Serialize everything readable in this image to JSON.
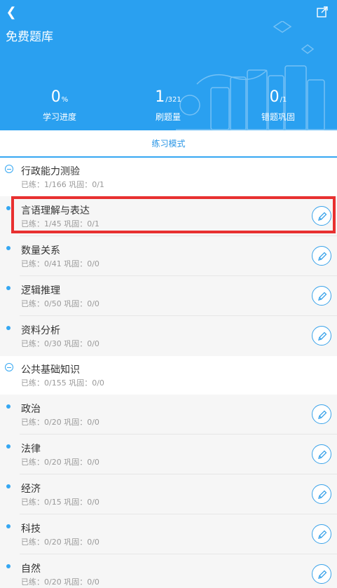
{
  "header": {
    "title": "免费题库",
    "bg_color": "#2aa0f0",
    "stats": [
      {
        "value": "0",
        "suffix": "%",
        "label": "学习进度"
      },
      {
        "value": "1",
        "suffix": "/321",
        "label": "刷题量"
      },
      {
        "value": "0",
        "suffix": "/1",
        "label": "错题巩固"
      }
    ]
  },
  "tab": {
    "label": "练习模式"
  },
  "groups": [
    {
      "title": "行政能力测验",
      "progress": "已练：1/166  巩固：0/1",
      "items": [
        {
          "name": "言语理解与表达",
          "progress": "已练：1/45  巩固：0/1"
        },
        {
          "name": "数量关系",
          "progress": "已练：0/41  巩固：0/0"
        },
        {
          "name": "逻辑推理",
          "progress": "已练：0/50  巩固：0/0"
        },
        {
          "name": "资料分析",
          "progress": "已练：0/30  巩固：0/0"
        }
      ]
    },
    {
      "title": "公共基础知识",
      "progress": "已练：0/155  巩固：0/0",
      "items": [
        {
          "name": "政治",
          "progress": "已练：0/20  巩固：0/0"
        },
        {
          "name": "法律",
          "progress": "已练：0/20  巩固：0/0"
        },
        {
          "name": "经济",
          "progress": "已练：0/15  巩固：0/0"
        },
        {
          "name": "科技",
          "progress": "已练：0/20  巩固：0/0"
        },
        {
          "name": "自然",
          "progress": "已练：0/20  巩固：0/0"
        }
      ]
    }
  ]
}
